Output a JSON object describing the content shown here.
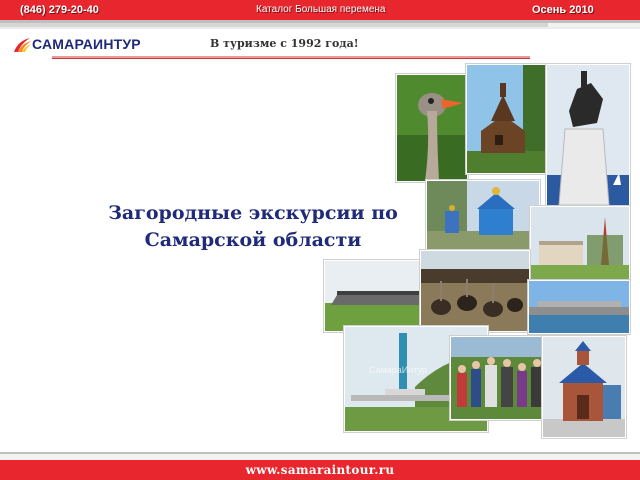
{
  "header": {
    "phone": "(846) 279-20-40",
    "catalog": "Каталог Большая перемена",
    "season": "Осень 2010"
  },
  "logo": {
    "name": "САМАРАИНТУР",
    "slogan": "В туризме с 1992 года!"
  },
  "main": {
    "title_line1": "Загородные экскурсии по",
    "title_line2": "Самарской области"
  },
  "collage": {
    "watermark": "СамараИнтур",
    "photos": [
      "ostrich-photo",
      "wooden-church-photo",
      "equestrian-monument-photo",
      "blue-church-photo",
      "city-square-photo",
      "stadium-photo",
      "ostrich-farm-photo",
      "dam-photo",
      "stele-photo",
      "group-photo",
      "chapel-photo"
    ]
  },
  "footer": {
    "website": "www.samaraintour.ru"
  },
  "colors": {
    "brand_red": "#e8262d",
    "brand_blue": "#1f2a78"
  }
}
